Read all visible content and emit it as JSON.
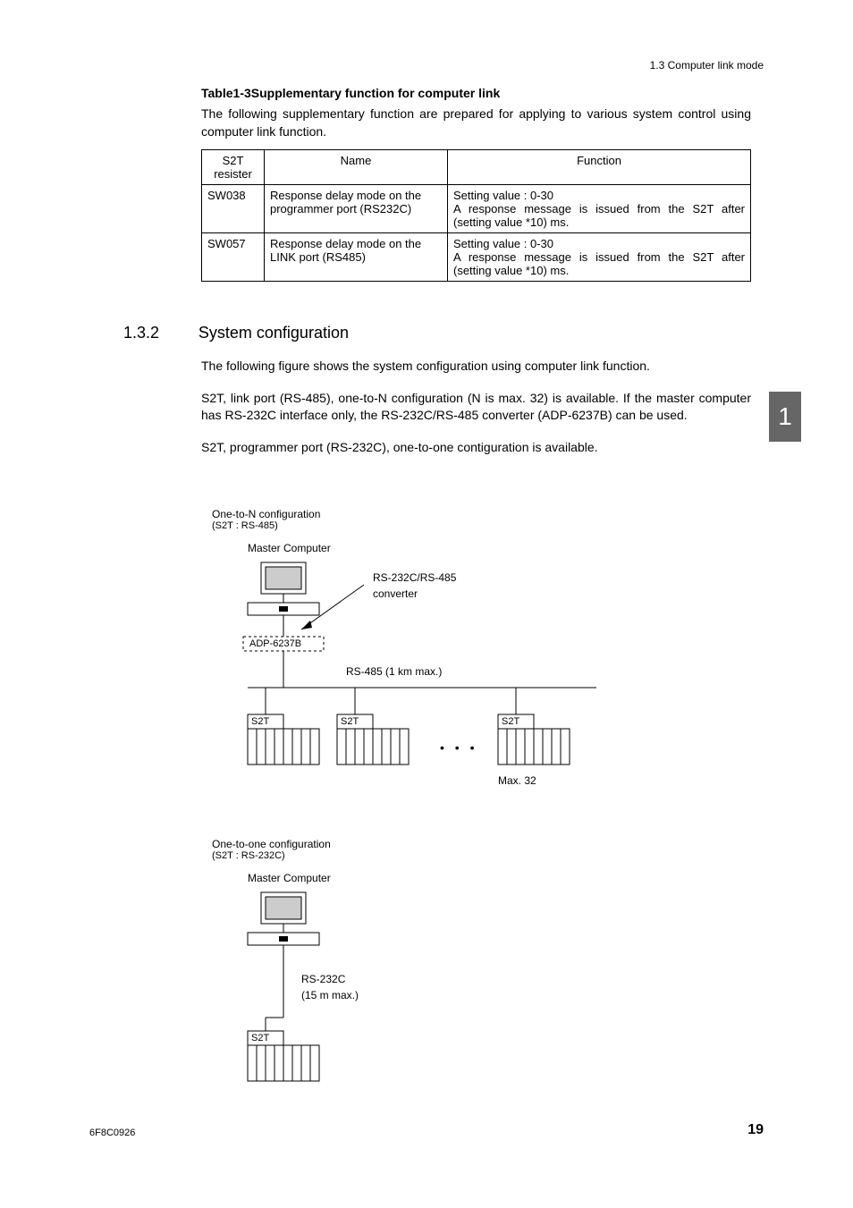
{
  "header": {
    "breadcrumb": "1.3  Computer link mode"
  },
  "table": {
    "title": "Table1-3Supplementary function for computer link",
    "intro": "The following supplementary function are prepared for applying to various system control using computer link function.",
    "headers": {
      "col1_line1": "S2T",
      "col1_line2": "resister",
      "col2": "Name",
      "col3": "Function"
    },
    "rows": [
      {
        "resister": "SW038",
        "name": "Response delay mode on the programmer port (RS232C)",
        "function": "Setting value : 0-30\nA response message is issued from the S2T after (setting value *10) ms."
      },
      {
        "resister": "SW057",
        "name": "Response delay mode on the LINK port (RS485)",
        "function": "Setting value : 0-30\nA response message is issued from the S2T after (setting value *10) ms."
      }
    ]
  },
  "section": {
    "number": "1.3.2",
    "title": "System configuration",
    "p1": "The following figure shows the system configuration using computer link function.",
    "p2": "S2T, link port (RS-485), one-to-N configuration (N is max. 32) is available. If the master computer has RS-232C interface only, the RS-232C/RS-485 converter (ADP-6237B) can be used.",
    "p3": "S2T, programmer port (RS-232C), one-to-one contiguration is available."
  },
  "diagram1": {
    "title": "One-to-N configuration",
    "sub": "(S2T : RS-485)",
    "master": "Master Computer",
    "converter_l1": "RS-232C/RS-485",
    "converter_l2": "converter",
    "adp": "ADP-6237B",
    "bus": "RS-485 (1 km max.)",
    "node": "S2T",
    "max": "Max. 32",
    "dots": "• • •"
  },
  "diagram2": {
    "title": "One-to-one configuration",
    "sub": "(S2T : RS-232C)",
    "master": "Master Computer",
    "cable_l1": "RS-232C",
    "cable_l2": "(15 m max.)",
    "node": "S2T"
  },
  "side_tab": "1",
  "footer": {
    "left": "6F8C0926",
    "right": "19"
  }
}
